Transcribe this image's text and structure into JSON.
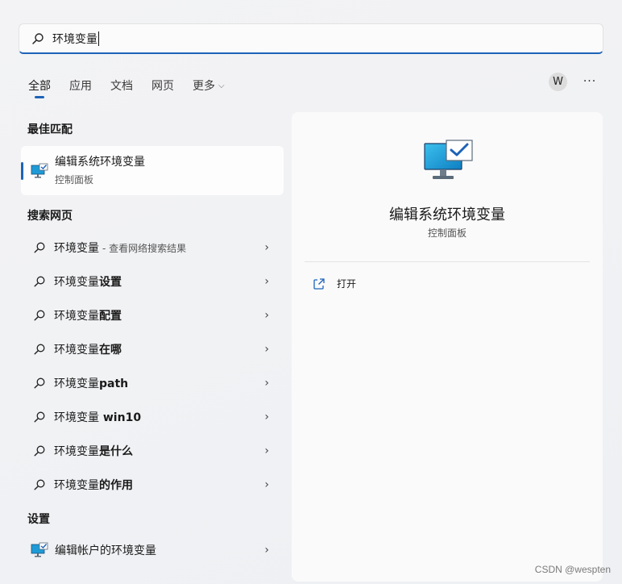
{
  "search": {
    "query": "环境变量"
  },
  "tabs": [
    {
      "label": "全部",
      "active": true
    },
    {
      "label": "应用"
    },
    {
      "label": "文档"
    },
    {
      "label": "网页"
    },
    {
      "label": "更多",
      "has_dropdown": true
    }
  ],
  "header": {
    "avatar_letter": "W",
    "more_label": "···"
  },
  "sections": {
    "best_match": "最佳匹配",
    "web_search": "搜索网页",
    "settings": "设置"
  },
  "best_match": {
    "title": "编辑系统环境变量",
    "subtitle": "控制面板",
    "icon": "system-monitor-check-icon"
  },
  "web_results": [
    {
      "prefix": "环境变量",
      "bold": "",
      "suffix": "- 查看网络搜索结果"
    },
    {
      "prefix": "环境变量",
      "bold": "设置",
      "suffix": ""
    },
    {
      "prefix": "环境变量",
      "bold": "配置",
      "suffix": ""
    },
    {
      "prefix": "环境变量",
      "bold": "在哪",
      "suffix": ""
    },
    {
      "prefix": "环境变量",
      "bold": "path",
      "suffix": ""
    },
    {
      "prefix": "环境变量",
      "bold": " win10",
      "suffix": ""
    },
    {
      "prefix": "环境变量",
      "bold": "是什么",
      "suffix": ""
    },
    {
      "prefix": "环境变量",
      "bold": "的作用",
      "suffix": ""
    }
  ],
  "settings_result": {
    "label": "编辑帐户的环境变量",
    "icon": "system-monitor-check-icon"
  },
  "detail": {
    "title": "编辑系统环境变量",
    "subtitle": "控制面板",
    "action_label": "打开",
    "action_icon": "open-external-icon"
  },
  "watermark": "CSDN @wespten",
  "colors": {
    "accent": "#1d63b8"
  }
}
